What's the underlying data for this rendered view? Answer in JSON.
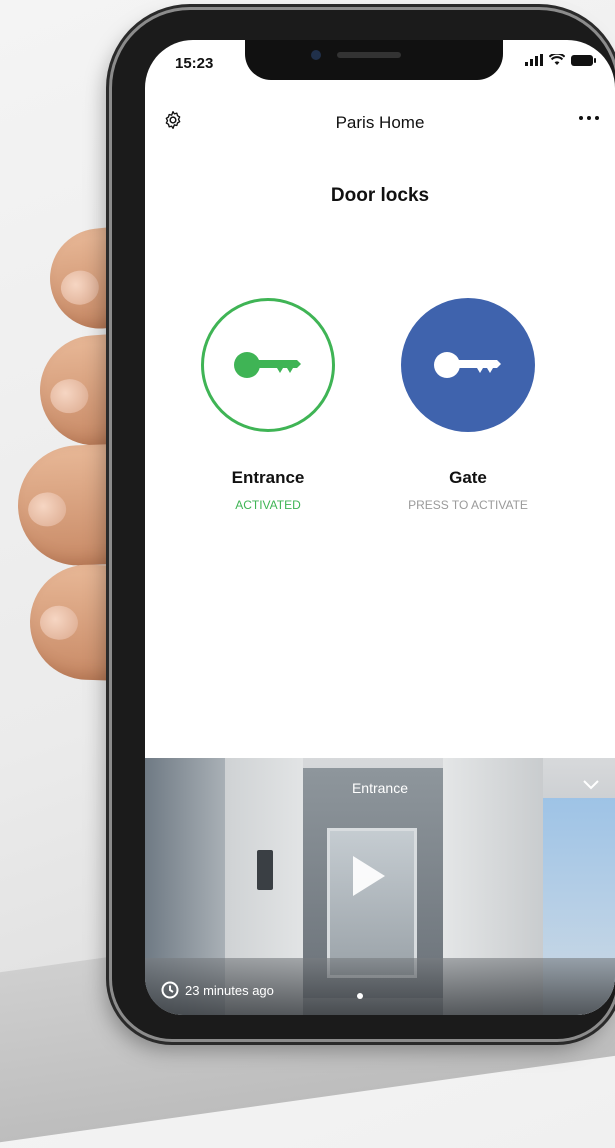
{
  "status_bar": {
    "time": "15:23"
  },
  "header": {
    "title": "Paris Home"
  },
  "section": {
    "title": "Door locks"
  },
  "locks": [
    {
      "name": "Entrance",
      "status": "ACTIVATED",
      "status_color": "#3fb455",
      "accent": "#3fb455",
      "icon": "key-icon"
    },
    {
      "name": "Gate",
      "status": "PRESS TO ACTIVATE",
      "status_color": "#9a9a9a",
      "accent": "#3f63ad",
      "icon": "key-icon"
    }
  ],
  "video": {
    "title": "Entrance",
    "timestamp": "23 minutes ago"
  }
}
